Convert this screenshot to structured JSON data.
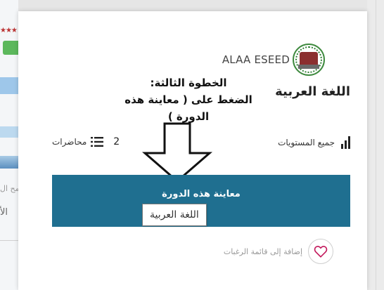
{
  "background": {
    "side_text_1": "ضمح ال",
    "side_text_2": "الأ"
  },
  "course_card": {
    "author": "ALAA ESEED",
    "instruction_line1": "الخطوة الثالثة:",
    "instruction_line2": "الضغط على ( معاينة هذه الدورة )",
    "course_title": "اللغة العربية",
    "levels_label": "جميع المستويات",
    "lectures_count": "2",
    "lectures_label": "محاضرات",
    "preview_button_label": "معاينة هذه الدورة",
    "tooltip": "اللغة العربية",
    "wishlist_label": "إضافة إلى قائمة الرغبات"
  },
  "colors": {
    "button": "#1f6f90",
    "heart": "#c2185b"
  },
  "icons": [
    "levels-bars-icon",
    "list-icon",
    "down-arrow-icon",
    "heart-icon",
    "academy-logo-icon"
  ]
}
